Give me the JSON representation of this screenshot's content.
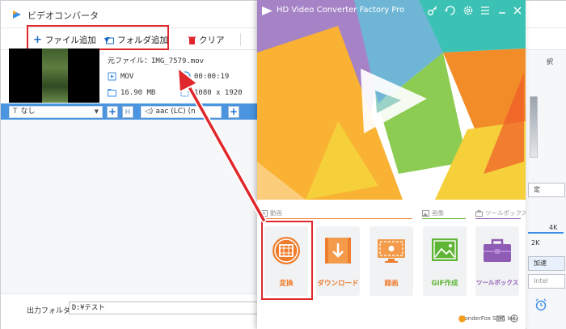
{
  "converter": {
    "title": "ビデオコンバータ",
    "toolbar": {
      "add_file": "ファイル追加",
      "add_folder": "フォルダ追加",
      "clear": "クリア"
    },
    "file": {
      "source_label": "元ファイル：",
      "source_name": "IMG_7579.mov",
      "format": "MOV",
      "duration": "00:00:19",
      "size": "16.90 MB",
      "resolution": "1080 x 1920"
    },
    "subtitle_value": "なし",
    "audio_value": "aac (LC) (n",
    "output_folder_label": "出力フォルダ：",
    "output_folder_value": "D:¥テスト",
    "right_panel": {
      "select_label": "択",
      "setting_label": "定",
      "res_4k": "4K",
      "res_2k": "2K",
      "accel_label": "加速",
      "intel_label": "Intel"
    }
  },
  "hd_app": {
    "title": "HD Video Converter Factory Pro",
    "sections": {
      "video": "動画",
      "image": "画像",
      "toolbox": "ツールボックス"
    },
    "tiles": [
      {
        "label": "変換",
        "color": "#ef7d2e",
        "icon": "film-reel-icon"
      },
      {
        "label": "ダウンロード",
        "color": "#ef7d2e",
        "icon": "download-icon"
      },
      {
        "label": "録画",
        "color": "#ef7d2e",
        "icon": "screen-record-icon"
      },
      {
        "label": "GIF作成",
        "color": "#5fb536",
        "icon": "image-icon"
      },
      {
        "label": "ツールボックス",
        "color": "#8e5bb5",
        "icon": "toolbox-icon"
      }
    ],
    "footer": "WonderFox Soft, Inc."
  },
  "colors": {
    "highlight": "#e0282c",
    "blue_bar": "#4a94e0",
    "orange": "#ef7d2e",
    "green": "#5fb536",
    "purple": "#8e5bb5"
  }
}
